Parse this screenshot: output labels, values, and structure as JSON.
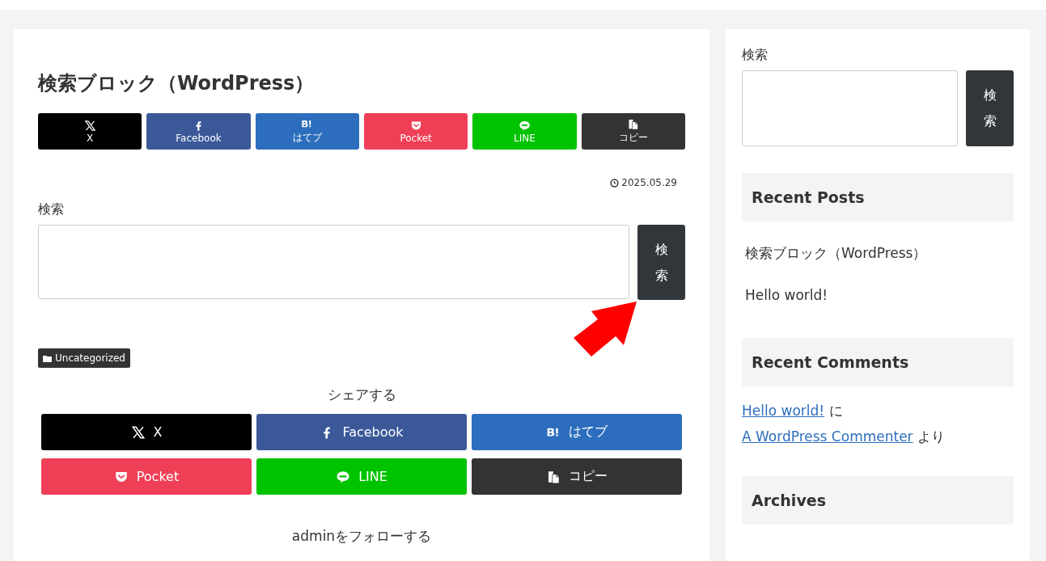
{
  "article": {
    "title": "検索ブロック（WordPress）",
    "top_share": [
      {
        "kind": "x",
        "label": "X"
      },
      {
        "kind": "facebook",
        "label": "Facebook"
      },
      {
        "kind": "hatena",
        "label": "はてブ"
      },
      {
        "kind": "pocket",
        "label": "Pocket"
      },
      {
        "kind": "line",
        "label": "LINE"
      },
      {
        "kind": "copy",
        "label": "コピー"
      }
    ],
    "date": "2025.05.29",
    "search": {
      "label": "検索",
      "button": "検索"
    },
    "category": "Uncategorized",
    "share_heading": "シェアする",
    "bottom_share": [
      {
        "kind": "x",
        "label": "X"
      },
      {
        "kind": "facebook",
        "label": "Facebook"
      },
      {
        "kind": "hatena",
        "label": "はてブ"
      },
      {
        "kind": "pocket",
        "label": "Pocket"
      },
      {
        "kind": "line",
        "label": "LINE"
      },
      {
        "kind": "copy",
        "label": "コピー"
      }
    ],
    "follow_heading": "adminをフォローする"
  },
  "sidebar": {
    "search": {
      "label": "検索",
      "button": "検索"
    },
    "recent_posts": {
      "title": "Recent Posts",
      "items": [
        "検索ブロック（WordPress）",
        "Hello world!"
      ]
    },
    "recent_comments": {
      "title": "Recent Comments",
      "comment": {
        "post": "Hello world!",
        "joiner": "に",
        "author": "A WordPress Commenter",
        "suffix": "より"
      }
    },
    "archives": {
      "title": "Archives"
    }
  }
}
